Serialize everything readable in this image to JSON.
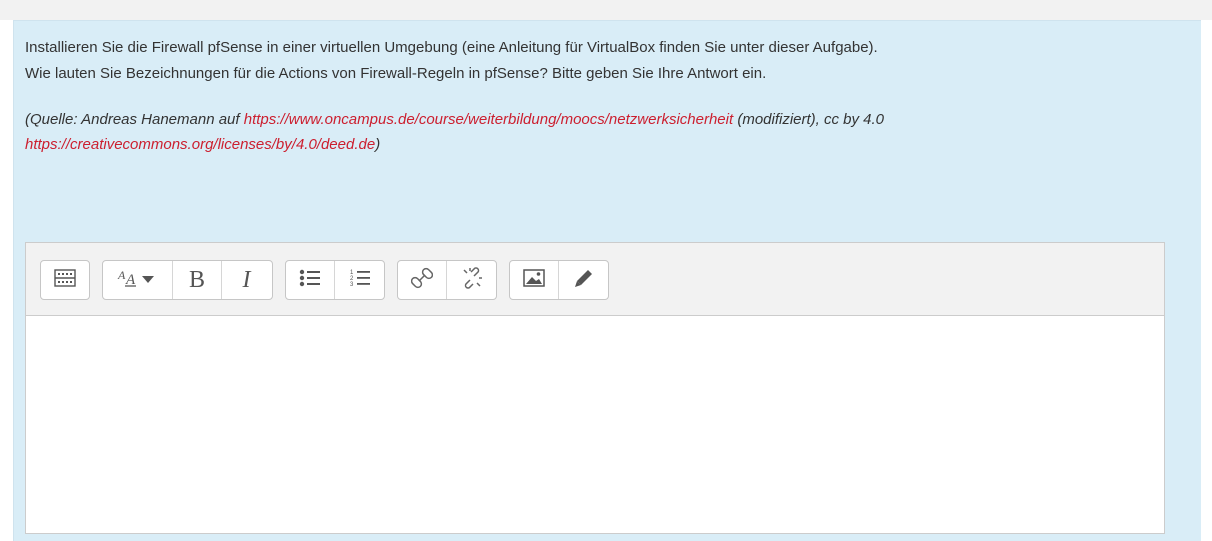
{
  "question": {
    "line1": "Installieren Sie die Firewall pfSense in einer virtuellen Umgebung (eine Anleitung für VirtualBox finden Sie unter dieser Aufgabe).",
    "line2": "Wie lauten Sie Bezeichnungen für die Actions von Firewall-Regeln in pfSense? Bitte geben Sie Ihre Antwort ein.",
    "source_prefix": "(Quelle: Andreas Hanemann auf ",
    "source_link1": "https://www.oncampus.de/course/weiterbildung/moocs/netzwerksicherheit",
    "source_middle": " (modifiziert), cc by 4.0",
    "source_link2": "https://creativecommons.org/licenses/by/4.0/deed.de",
    "source_suffix": ")"
  },
  "toolbar": {
    "bold_label": "B",
    "italic_label": "I",
    "icons": [
      "toggle-toolbar-icon",
      "text-style-icon",
      "bold-icon",
      "italic-icon",
      "unordered-list-icon",
      "ordered-list-icon",
      "link-icon",
      "unlink-icon",
      "image-icon",
      "pencil-icon"
    ]
  },
  "editor": {
    "content": ""
  },
  "colors": {
    "question_bg": "#d9edf7",
    "link": "#cc1f2f",
    "toolbar_bg": "#f2f2f2"
  }
}
